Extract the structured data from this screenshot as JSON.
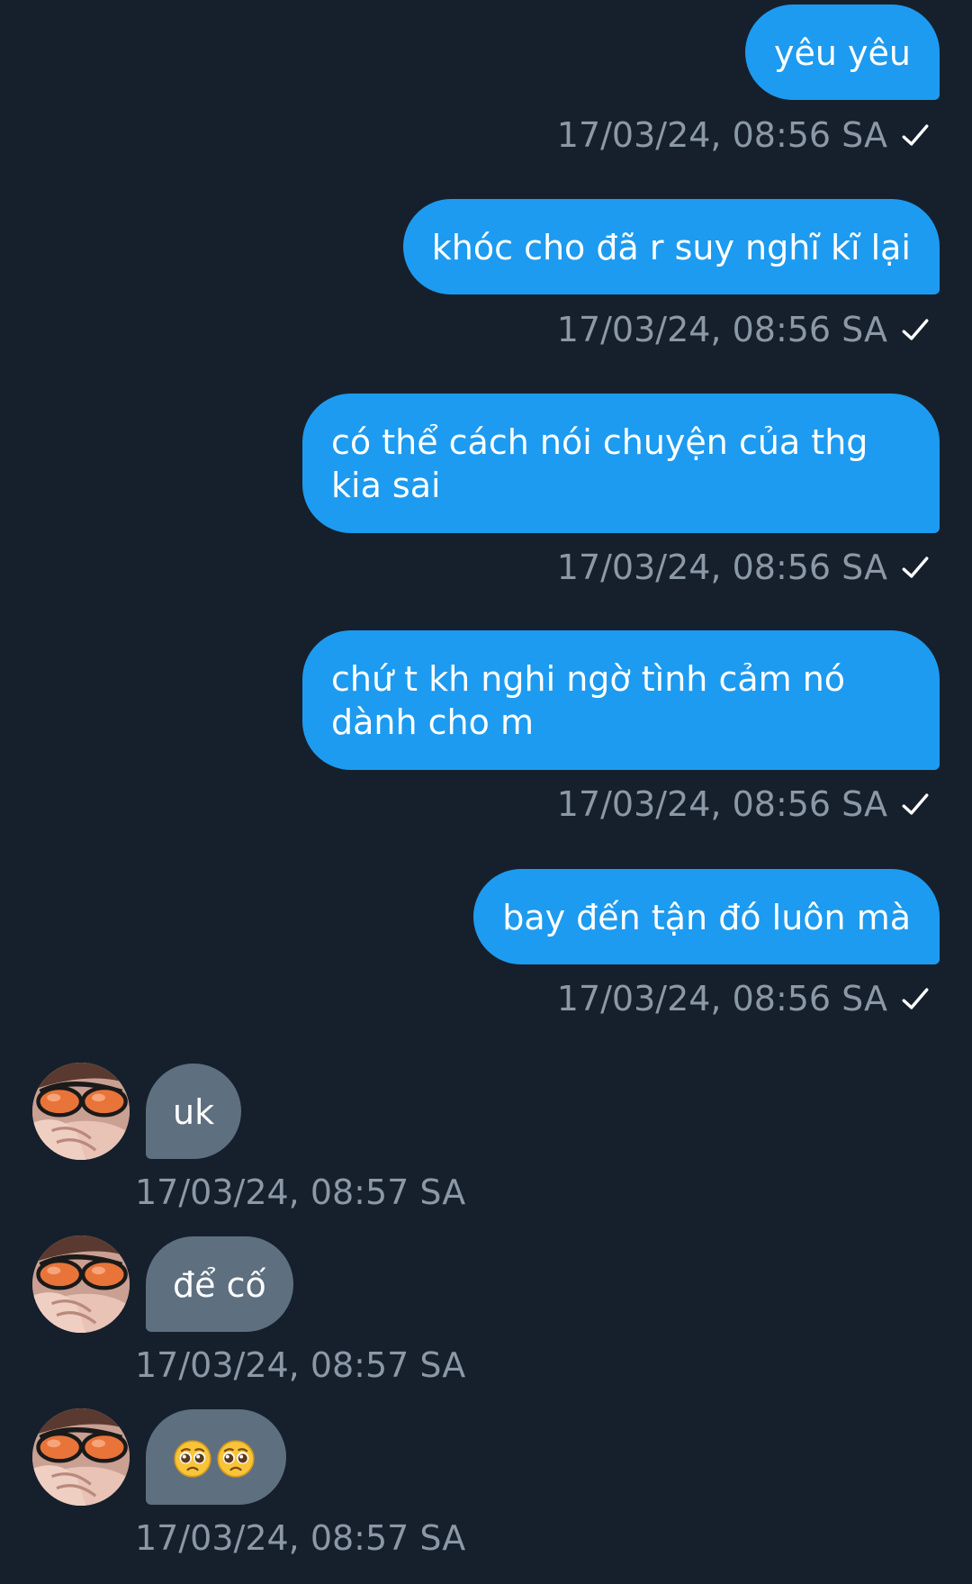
{
  "colors": {
    "background": "#16202c",
    "outgoing_bubble": "#1d9bf0",
    "incoming_bubble": "#5e6f80",
    "timestamp": "#8b98a5"
  },
  "messages": [
    {
      "direction": "outgoing",
      "text": "yêu yêu",
      "time": "17/03/24, 08:56 SA",
      "status_icon": "sent-check-icon"
    },
    {
      "direction": "outgoing",
      "text": "khóc cho đã r suy nghĩ kĩ lại",
      "time": "17/03/24, 08:56 SA",
      "status_icon": "sent-check-icon"
    },
    {
      "direction": "outgoing",
      "text": "có thể cách nói chuyện của thg kia sai",
      "time": "17/03/24, 08:56 SA",
      "status_icon": "sent-check-icon"
    },
    {
      "direction": "outgoing",
      "text": "chứ t kh nghi ngờ tình cảm nó dành cho m",
      "time": "17/03/24, 08:56 SA",
      "status_icon": "sent-check-icon"
    },
    {
      "direction": "outgoing",
      "text": "bay đến tận đó luôn mà",
      "time": "17/03/24, 08:56 SA",
      "status_icon": "sent-check-icon"
    },
    {
      "direction": "incoming",
      "text": "uk",
      "time": "17/03/24, 08:57 SA",
      "avatar_icon": "sender-avatar"
    },
    {
      "direction": "incoming",
      "text": "để cố",
      "time": "17/03/24, 08:57 SA",
      "avatar_icon": "sender-avatar"
    },
    {
      "direction": "incoming",
      "text": "",
      "emojis": [
        "pleading-face-emoji",
        "pleading-face-emoji"
      ],
      "time": "17/03/24, 08:57 SA",
      "avatar_icon": "sender-avatar"
    }
  ]
}
